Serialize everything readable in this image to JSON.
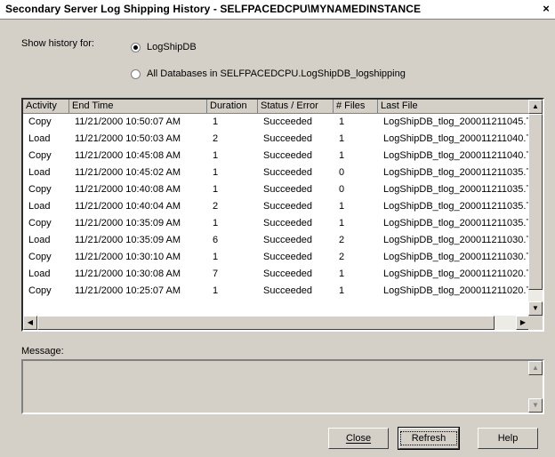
{
  "window": {
    "title": "Secondary Server Log Shipping History - SELFPACEDCPU\\MYNAMEDINSTANCE",
    "close_glyph": "×"
  },
  "history": {
    "label": "Show history for:",
    "option1": "LogShipDB",
    "option2": "All Databases in SELFPACEDCPU.LogShipDB_logshipping"
  },
  "grid": {
    "columns": [
      "Activity",
      "End Time",
      "Duration",
      "Status / Error",
      "# Files",
      "Last File"
    ],
    "rows": [
      [
        "Copy",
        "11/21/2000 10:50:07 AM",
        "1",
        "Succeeded",
        "1",
        "LogShipDB_tlog_200011211045.T"
      ],
      [
        "Load",
        "11/21/2000 10:50:03 AM",
        "2",
        "Succeeded",
        "1",
        "LogShipDB_tlog_200011211040.T"
      ],
      [
        "Copy",
        "11/21/2000 10:45:08 AM",
        "1",
        "Succeeded",
        "1",
        "LogShipDB_tlog_200011211040.T"
      ],
      [
        "Load",
        "11/21/2000 10:45:02 AM",
        "1",
        "Succeeded",
        "0",
        "LogShipDB_tlog_200011211035.T"
      ],
      [
        "Copy",
        "11/21/2000 10:40:08 AM",
        "1",
        "Succeeded",
        "0",
        "LogShipDB_tlog_200011211035.T"
      ],
      [
        "Load",
        "11/21/2000 10:40:04 AM",
        "2",
        "Succeeded",
        "1",
        "LogShipDB_tlog_200011211035.T"
      ],
      [
        "Copy",
        "11/21/2000 10:35:09 AM",
        "1",
        "Succeeded",
        "1",
        "LogShipDB_tlog_200011211035.T"
      ],
      [
        "Load",
        "11/21/2000 10:35:09 AM",
        "6",
        "Succeeded",
        "2",
        "LogShipDB_tlog_200011211030.T"
      ],
      [
        "Copy",
        "11/21/2000 10:30:10 AM",
        "1",
        "Succeeded",
        "2",
        "LogShipDB_tlog_200011211030.T"
      ],
      [
        "Load",
        "11/21/2000 10:30:08 AM",
        "7",
        "Succeeded",
        "1",
        "LogShipDB_tlog_200011211020.T"
      ],
      [
        "Copy",
        "11/21/2000 10:25:07 AM",
        "1",
        "Succeeded",
        "1",
        "LogShipDB_tlog_200011211020.T"
      ]
    ]
  },
  "message": {
    "label": "Message:",
    "value": ""
  },
  "buttons": {
    "close": "Close",
    "refresh": "Refresh",
    "help": "Help"
  }
}
